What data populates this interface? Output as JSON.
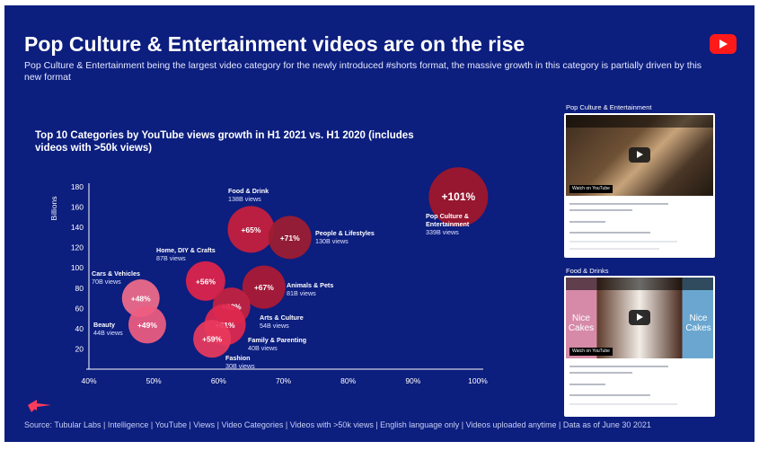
{
  "header": {
    "title": "Pop Culture & Entertainment videos are on the rise",
    "subtitle": "Pop Culture & Entertainment being the largest video category for the newly introduced #shorts format, the massive growth in this category is partially driven by this new format"
  },
  "chart_title": "Top 10 Categories by YouTube views growth in H1 2021 vs. H1 2020 (includes videos with >50k views)",
  "chart_data": {
    "type": "scatter",
    "title": "Top 10 Categories by YouTube views growth in H1 2021 vs. H1 2020 (includes videos with >50k views)",
    "xlabel": "",
    "ylabel": "Billions",
    "xlim": [
      40,
      100
    ],
    "ylim": [
      0,
      180
    ],
    "x_ticks": [
      "40%",
      "50%",
      "60%",
      "70%",
      "80%",
      "90%",
      "100%"
    ],
    "y_ticks": [
      "20",
      "40",
      "60",
      "80",
      "100",
      "120",
      "140",
      "160",
      "180"
    ],
    "grid": false,
    "points": [
      {
        "label": "Pop Culture & Entertainment",
        "views": "339B views",
        "growth_label": "+101%",
        "x": 97,
        "y": 170,
        "color": "#a3162a"
      },
      {
        "label": "Food & Drink",
        "views": "138B views",
        "growth_label": "+65%",
        "x": 65,
        "y": 138,
        "color": "#c81f3c"
      },
      {
        "label": "People & Lifestyles",
        "views": "130B views",
        "growth_label": "+71%",
        "x": 71,
        "y": 130,
        "color": "#9e1c30"
      },
      {
        "label": "Home, DIY & Crafts",
        "views": "87B views",
        "growth_label": "+56%",
        "x": 58,
        "y": 87,
        "color": "#e0244a"
      },
      {
        "label": "Animals & Pets",
        "views": "81B views",
        "growth_label": "+67%",
        "x": 67,
        "y": 81,
        "color": "#ae1a34"
      },
      {
        "label": "Cars & Vehicles",
        "views": "70B views",
        "growth_label": "+48%",
        "x": 48,
        "y": 70,
        "color": "#f06c8a"
      },
      {
        "label": "Arts & Culture",
        "views": "54B views",
        "growth_label": "+62%",
        "x": 62,
        "y": 62,
        "color": "#c42140"
      },
      {
        "label": "Beauty",
        "views": "44B views",
        "growth_label": "+49%",
        "x": 49,
        "y": 44,
        "color": "#ee5c80"
      },
      {
        "label": "Family & Parenting",
        "views": "40B views",
        "growth_label": "+61%",
        "x": 61,
        "y": 44,
        "color": "#e0294f"
      },
      {
        "label": "Fashion",
        "views": "30B views",
        "growth_label": "+59%",
        "x": 59,
        "y": 30,
        "color": "#e83a5c"
      }
    ]
  },
  "panels": {
    "pop_title": "Pop Culture & Entertainment",
    "food_title": "Food & Drinks",
    "cake_left": "Nice Cakes",
    "cake_right": "Nice Cakes",
    "watch_on": "Watch on YouTube"
  },
  "source": "Source: Tubular Labs | Intelligence | YouTube | Views | Video Categories | Videos with >50k views | English language only | Videos uploaded anytime | Data as of June 30 2021",
  "colors": {
    "background": "#0c1e7e",
    "accent": "#ff1a1a",
    "logo": "#ff3b5c"
  }
}
